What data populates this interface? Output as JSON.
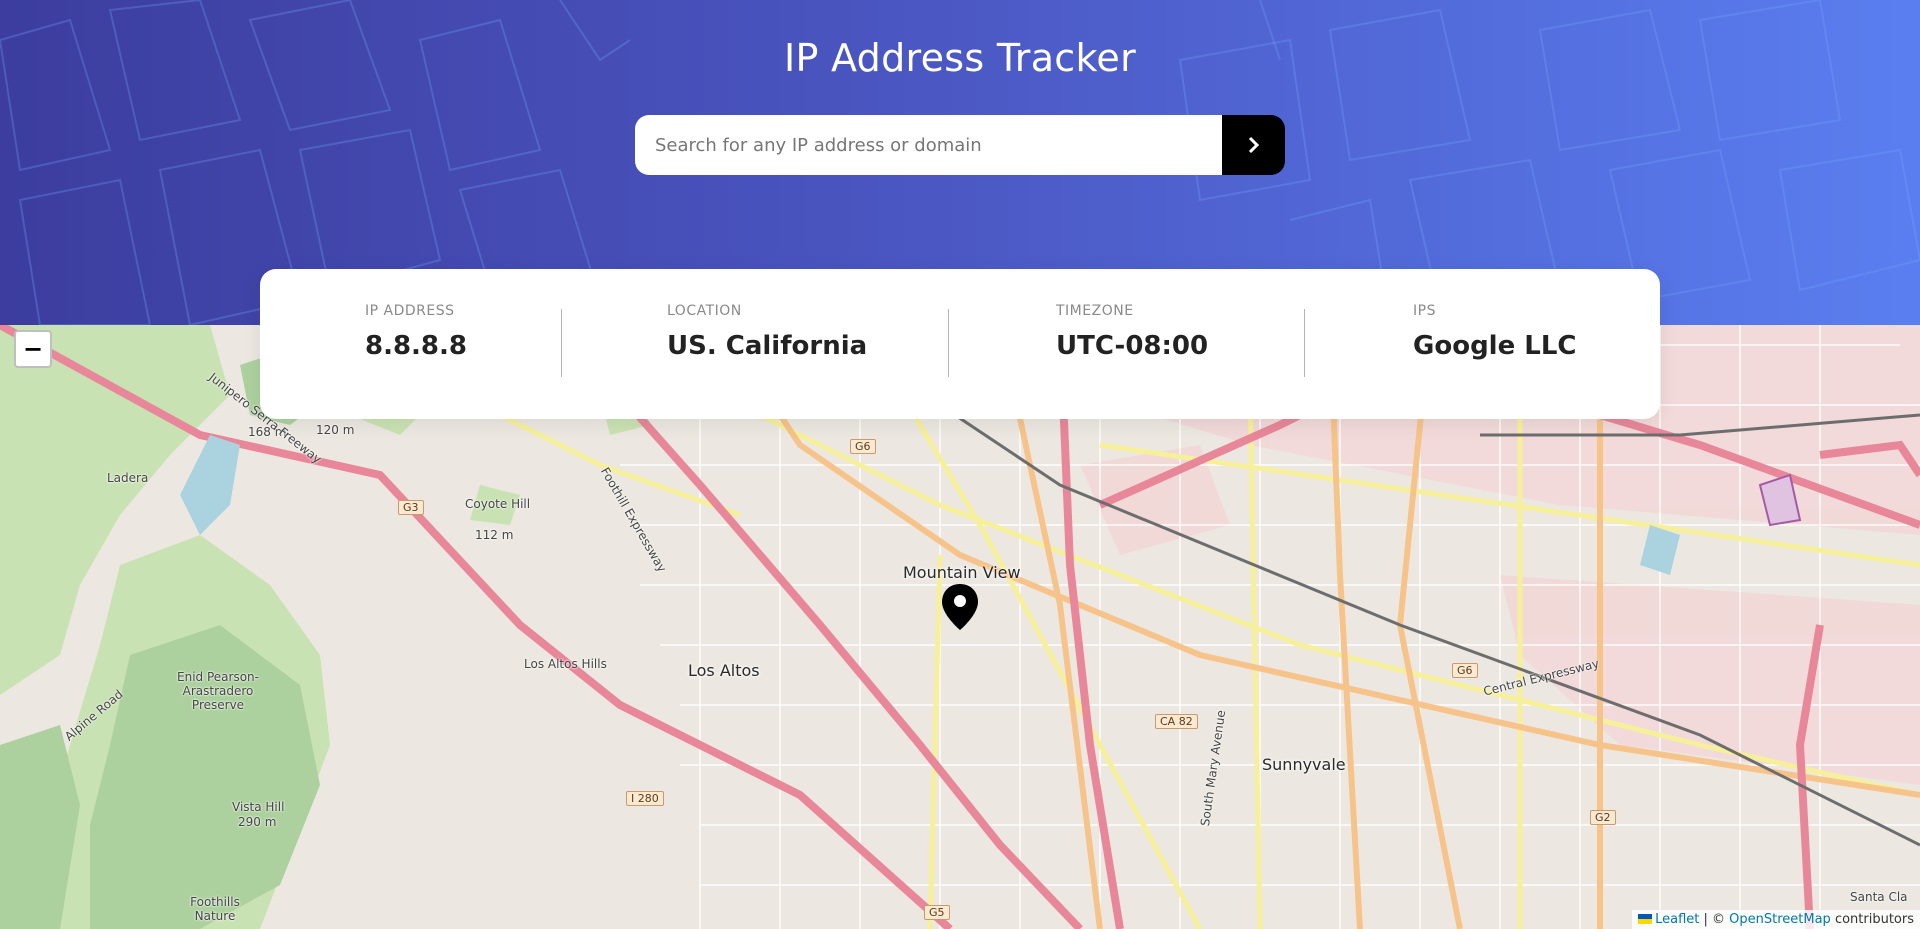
{
  "header": {
    "title": "IP Address Tracker",
    "search_placeholder": "Search for any IP address or domain",
    "search_button_icon": "chevron-right-icon"
  },
  "info": {
    "ip_label": "IP ADDRESS",
    "ip_value": "8.8.8.8",
    "location_label": "LOCATION",
    "location_value": "US. California",
    "timezone_label": "TIMEZONE",
    "timezone_value": "UTC-08:00",
    "isp_label": "IPS",
    "isp_value": "Google LLC"
  },
  "map": {
    "zoom_out_label": "−",
    "marker_icon": "location-pin-icon",
    "labels": {
      "mountain_view": "Mountain View",
      "los_altos": "Los Altos",
      "los_altos_hills": "Los Altos Hills",
      "sunnyvale": "Sunnyvale",
      "ladera": "Ladera",
      "coyote_hill": "Coyote Hill",
      "coyote_hill_elev": "112 m",
      "vista_hill": "Vista Hill",
      "vista_hill_elev": "290 m",
      "enid_pearson": "Enid Pearson-Arastradero Preserve",
      "foothills_nature": "Foothills Nature",
      "santa_clara": "Santa Cla",
      "elev_168": "168 m",
      "elev_120": "120 m",
      "foothill_expressway": "Foothill Expressway",
      "central_expressway": "Central Expressway",
      "junipero_serra": "Junipero Serra Freeway",
      "south_mary": "South Mary Avenue",
      "alpine_road": "Alpine Road",
      "shield_g6": "G6",
      "shield_g3": "G3",
      "shield_i280": "I 280",
      "shield_ca82": "CA 82",
      "shield_g2": "G2",
      "shield_g5": "G5"
    },
    "attribution": {
      "leaflet": "Leaflet",
      "separator": " | © ",
      "osm": "OpenStreetMap",
      "contributors": " contributors"
    }
  }
}
